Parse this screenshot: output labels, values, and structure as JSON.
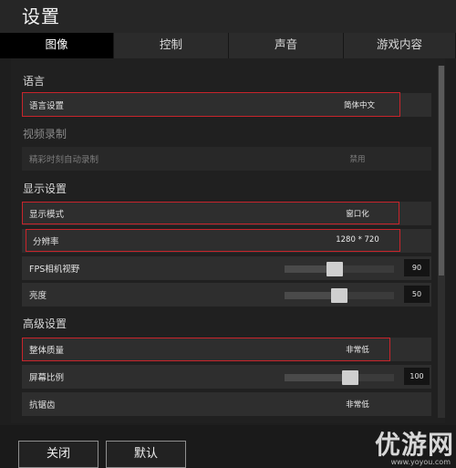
{
  "window": {
    "title": "设置"
  },
  "tabs": [
    {
      "label": "图像",
      "active": true
    },
    {
      "label": "控制",
      "active": false
    },
    {
      "label": "声音",
      "active": false
    },
    {
      "label": "游戏内容",
      "active": false
    }
  ],
  "sections": {
    "language": {
      "title": "语言"
    },
    "video_recording": {
      "title": "视频录制"
    },
    "display": {
      "title": "显示设置"
    },
    "advanced": {
      "title": "高级设置"
    }
  },
  "rows": {
    "language_setting": {
      "label": "语言设置",
      "value": "简体中文"
    },
    "auto_record": {
      "label": "精彩时刻自动录制",
      "value": "禁用"
    },
    "display_mode": {
      "label": "显示模式",
      "value": "窗口化"
    },
    "resolution": {
      "label": "分辨率",
      "value": "1280 * 720"
    },
    "fps_fov": {
      "label": "FPS相机视野",
      "value": "90",
      "level": 0.45
    },
    "brightness": {
      "label": "亮度",
      "value": "50",
      "level": 0.5
    },
    "overall_quality": {
      "label": "整体质量",
      "value": "非常低"
    },
    "screen_scale": {
      "label": "屏幕比例",
      "value": "100",
      "level": 0.62
    },
    "anti_aliasing": {
      "label": "抗锯齿",
      "value": "非常低"
    }
  },
  "buttons": {
    "close": "关闭",
    "default": "默认"
  },
  "watermark": {
    "text": "优游网",
    "url": "www.yoyou.com"
  },
  "colors": {
    "highlight": "#c8242b",
    "active_tab": "#000000"
  }
}
